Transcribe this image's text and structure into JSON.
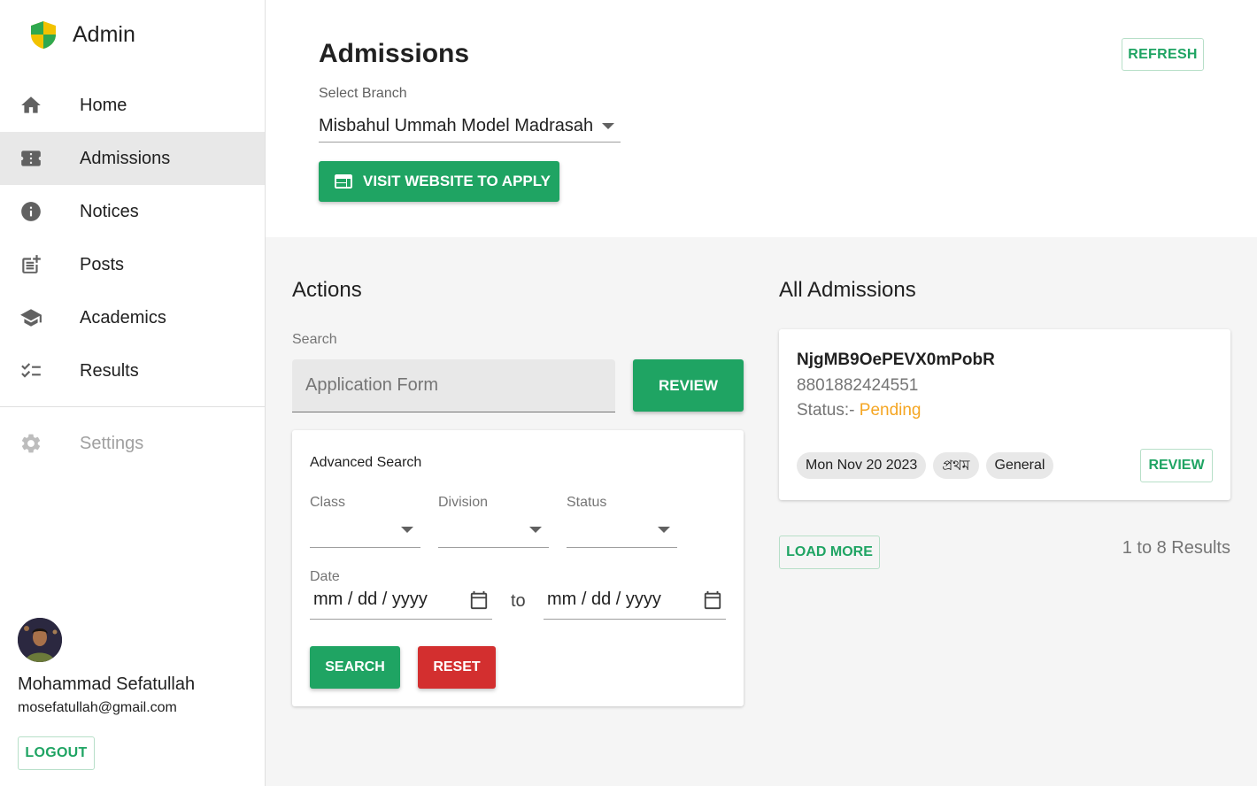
{
  "brand": {
    "title": "Admin"
  },
  "sidebar": {
    "items": [
      {
        "label": "Home",
        "icon": "home-icon"
      },
      {
        "label": "Admissions",
        "icon": "ticket-icon",
        "active": true
      },
      {
        "label": "Notices",
        "icon": "info-icon"
      },
      {
        "label": "Posts",
        "icon": "post-add-icon"
      },
      {
        "label": "Academics",
        "icon": "school-icon"
      },
      {
        "label": "Results",
        "icon": "checklist-icon"
      }
    ],
    "settings": {
      "label": "Settings",
      "icon": "gear-icon",
      "disabled": true
    }
  },
  "user": {
    "name": "Mohammad Sefatullah",
    "email": "mosefatullah@gmail.com",
    "logout_label": "LOGOUT"
  },
  "header": {
    "title": "Admissions",
    "refresh_label": "REFRESH",
    "branch_label": "Select Branch",
    "branch_value": "Misbahul Ummah Model Madrasah",
    "visit_label": "VISIT WEBSITE TO APPLY"
  },
  "actions": {
    "title": "Actions",
    "search_label": "Search",
    "search_placeholder": "Application Form",
    "review_label": "REVIEW",
    "advanced": {
      "title": "Advanced Search",
      "class_label": "Class",
      "division_label": "Division",
      "status_label": "Status",
      "date_label": "Date",
      "date_from": "mm / dd / yyyy",
      "to_label": "to",
      "date_to": "mm / dd / yyyy",
      "search_label": "SEARCH",
      "reset_label": "RESET"
    }
  },
  "admissions": {
    "title": "All Admissions",
    "items": [
      {
        "id": "NjgMB9OePEVX0mPobR",
        "phone": "8801882424551",
        "status_prefix": "Status:-",
        "status": "Pending",
        "chips": [
          "Mon Nov 20 2023",
          "প্রথম",
          "General"
        ],
        "review_label": "REVIEW"
      }
    ],
    "load_more_label": "LOAD MORE",
    "results_text": "1 to 8 Results"
  },
  "colors": {
    "primary": "#1fa463",
    "danger": "#d32f2f",
    "pending": "#f5a623"
  }
}
